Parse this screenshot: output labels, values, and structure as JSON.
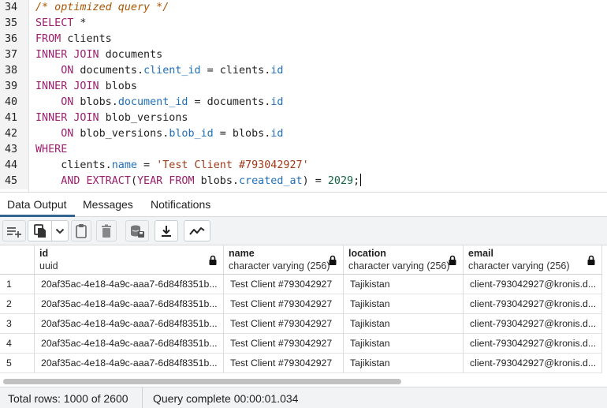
{
  "editor": {
    "lines": [
      {
        "num": "34",
        "parts": [
          [
            "cm",
            "/* optimized query */"
          ]
        ]
      },
      {
        "num": "35",
        "parts": [
          [
            "kw",
            "SELECT"
          ],
          [
            "",
            " *"
          ]
        ]
      },
      {
        "num": "36",
        "parts": [
          [
            "kw",
            "FROM"
          ],
          [
            "",
            " clients"
          ]
        ]
      },
      {
        "num": "37",
        "parts": [
          [
            "kw",
            "INNER JOIN"
          ],
          [
            "",
            " documents"
          ]
        ]
      },
      {
        "num": "38",
        "parts": [
          [
            "",
            "    "
          ],
          [
            "kw",
            "ON"
          ],
          [
            "",
            " documents."
          ],
          [
            "prop",
            "client_id"
          ],
          [
            "",
            " = clients."
          ],
          [
            "prop",
            "id"
          ]
        ]
      },
      {
        "num": "39",
        "parts": [
          [
            "kw",
            "INNER JOIN"
          ],
          [
            "",
            " blobs"
          ]
        ]
      },
      {
        "num": "40",
        "parts": [
          [
            "",
            "    "
          ],
          [
            "kw",
            "ON"
          ],
          [
            "",
            " blobs."
          ],
          [
            "prop",
            "document_id"
          ],
          [
            "",
            " = documents."
          ],
          [
            "prop",
            "id"
          ]
        ]
      },
      {
        "num": "41",
        "parts": [
          [
            "kw",
            "INNER JOIN"
          ],
          [
            "",
            " blob_versions"
          ]
        ]
      },
      {
        "num": "42",
        "parts": [
          [
            "",
            "    "
          ],
          [
            "kw",
            "ON"
          ],
          [
            "",
            " blob_versions."
          ],
          [
            "prop",
            "blob_id"
          ],
          [
            "",
            " = blobs."
          ],
          [
            "prop",
            "id"
          ]
        ]
      },
      {
        "num": "43",
        "parts": [
          [
            "kw",
            "WHERE"
          ]
        ]
      },
      {
        "num": "44",
        "parts": [
          [
            "",
            "    clients."
          ],
          [
            "prop",
            "name"
          ],
          [
            "",
            " = "
          ],
          [
            "str",
            "'Test Client #793042927'"
          ]
        ]
      },
      {
        "num": "45",
        "parts": [
          [
            "",
            "    "
          ],
          [
            "kw",
            "AND EXTRACT"
          ],
          [
            "",
            "("
          ],
          [
            "kw",
            "YEAR FROM"
          ],
          [
            "",
            " blobs."
          ],
          [
            "prop",
            "created_at"
          ],
          [
            "",
            ") = "
          ],
          [
            "num",
            "2029"
          ],
          [
            "",
            ";"
          ]
        ]
      }
    ]
  },
  "tabs": {
    "data_output": "Data Output",
    "messages": "Messages",
    "notifications": "Notifications"
  },
  "toolbar": {
    "icons": [
      "add-row-icon",
      "copy-icon",
      "chevron-down-icon",
      "paste-icon",
      "delete-icon",
      "save-data-icon",
      "download-icon",
      "graph-icon"
    ]
  },
  "grid": {
    "columns": [
      {
        "name": "id",
        "type": "uuid"
      },
      {
        "name": "name",
        "type": "character varying (256)"
      },
      {
        "name": "location",
        "type": "character varying (256)"
      },
      {
        "name": "email",
        "type": "character varying (256)"
      }
    ],
    "rows": [
      {
        "n": "1",
        "id": "20af35ac-4e18-4a9c-aaa7-6d84f8351b...",
        "name": "Test Client #793042927",
        "location": "Tajikistan",
        "email": "client-793042927@kronis.d..."
      },
      {
        "n": "2",
        "id": "20af35ac-4e18-4a9c-aaa7-6d84f8351b...",
        "name": "Test Client #793042927",
        "location": "Tajikistan",
        "email": "client-793042927@kronis.d..."
      },
      {
        "n": "3",
        "id": "20af35ac-4e18-4a9c-aaa7-6d84f8351b...",
        "name": "Test Client #793042927",
        "location": "Tajikistan",
        "email": "client-793042927@kronis.d..."
      },
      {
        "n": "4",
        "id": "20af35ac-4e18-4a9c-aaa7-6d84f8351b...",
        "name": "Test Client #793042927",
        "location": "Tajikistan",
        "email": "client-793042927@kronis.d..."
      },
      {
        "n": "5",
        "id": "20af35ac-4e18-4a9c-aaa7-6d84f8351b...",
        "name": "Test Client #793042927",
        "location": "Tajikistan",
        "email": "client-793042927@kronis.d..."
      }
    ]
  },
  "status": {
    "total_rows": "Total rows: 1000 of 2600",
    "query_complete": "Query complete 00:00:01.034"
  },
  "colors": {
    "keyword": "#9b1f6a",
    "property": "#1e6fb8",
    "string": "#a13a1a",
    "number": "#116644",
    "comment": "#aa5500",
    "active_tab": "#326690"
  }
}
